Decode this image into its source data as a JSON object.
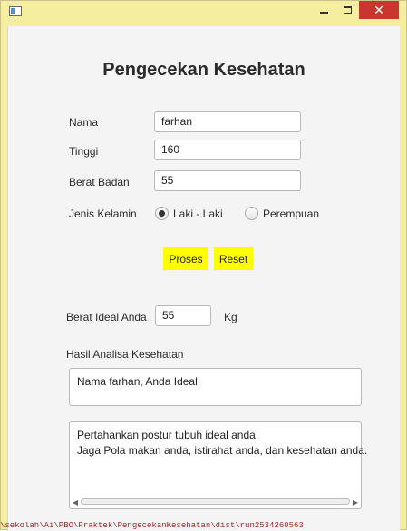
{
  "window": {
    "icon": "app-window-icon",
    "controls": {
      "minimize": "",
      "maximize": "",
      "close": "✕"
    }
  },
  "form": {
    "title": "Pengecekan Kesehatan",
    "nama_label": "Nama",
    "nama_value": "farhan",
    "tinggi_label": "Tinggi",
    "tinggi_value": "160",
    "berat_label": "Berat Badan",
    "berat_value": "55",
    "gender_label": "Jenis Kelamin",
    "gender_options": [
      "Laki - Laki",
      "Perempuan"
    ],
    "gender_selected": "Laki - Laki"
  },
  "actions": {
    "proses": "Proses",
    "reset": "Reset",
    "accent": "#ffff00"
  },
  "result": {
    "ideal_label": "Berat Ideal Anda",
    "ideal_value": "55",
    "ideal_unit": "Kg",
    "analysis_label": "Hasil Analisa Kesehatan",
    "analysis_text": "Nama farhan, Anda Ideal",
    "advice_line1": "Pertahankan postur tubuh ideal anda.",
    "advice_line2": "Jaga Pola makan anda, istirahat anda, dan kesehatan anda."
  },
  "background_text": "\\sekolah\\Ai\\PBO\\Praktek\\PengecekanKesehatan\\dist\\run2534260563"
}
